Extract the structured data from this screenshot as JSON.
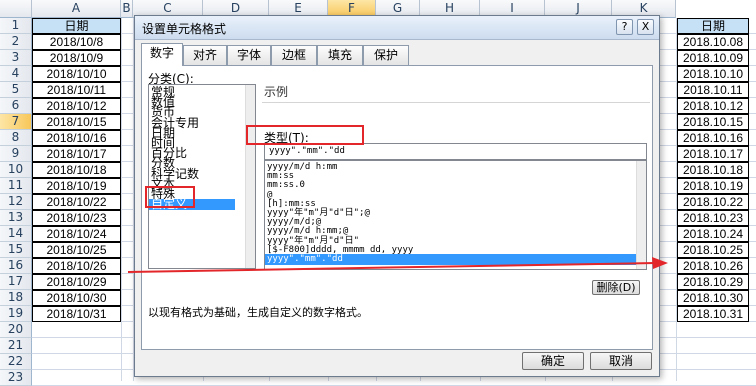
{
  "columns": [
    "A",
    "B",
    "C",
    "D",
    "E",
    "F",
    "G",
    "H",
    "I",
    "J",
    "K"
  ],
  "rows": [
    "1",
    "2",
    "3",
    "4",
    "5",
    "6",
    "7",
    "8",
    "9",
    "10",
    "11",
    "12",
    "13",
    "14",
    "15",
    "16",
    "17",
    "18",
    "19",
    "20",
    "21",
    "22",
    "23"
  ],
  "col_a": {
    "header": "日期",
    "values": [
      "2018/10/8",
      "2018/10/9",
      "2018/10/10",
      "2018/10/11",
      "2018/10/12",
      "2018/10/15",
      "2018/10/16",
      "2018/10/17",
      "2018/10/18",
      "2018/10/19",
      "2018/10/22",
      "2018/10/23",
      "2018/10/24",
      "2018/10/25",
      "2018/10/26",
      "2018/10/29",
      "2018/10/30",
      "2018/10/31"
    ]
  },
  "col_k": {
    "header": "日期",
    "values": [
      "2018.10.08",
      "2018.10.09",
      "2018.10.10",
      "2018.10.11",
      "2018.10.12",
      "2018.10.15",
      "2018.10.16",
      "2018.10.17",
      "2018.10.18",
      "2018.10.19",
      "2018.10.22",
      "2018.10.23",
      "2018.10.24",
      "2018.10.25",
      "2018.10.26",
      "2018.10.29",
      "2018.10.30",
      "2018.10.31"
    ]
  },
  "dialog": {
    "title": "设置单元格格式",
    "help": "?",
    "close": "X",
    "tabs": [
      "数字",
      "对齐",
      "字体",
      "边框",
      "填充",
      "保护"
    ],
    "category_label": "分类(C):",
    "categories": [
      "常规",
      "数值",
      "货币",
      "会计专用",
      "日期",
      "时间",
      "百分比",
      "分数",
      "科学记数",
      "文本",
      "特殊",
      "自定义"
    ],
    "sample_label": "示例",
    "type_label": "类型(T):",
    "type_value": "yyyy\".\"mm\".\"dd",
    "formats": [
      "yyyy/m/d h:mm",
      "mm:ss",
      "mm:ss.0",
      "@",
      "[h]:mm:ss",
      "yyyy\"年\"m\"月\"d\"日\";@",
      "yyyy/m/d;@",
      "yyyy/m/d h:mm;@",
      "yyyy\"年\"m\"月\"d\"日\"",
      "[$-F800]dddd, mmmm dd, yyyy",
      "yyyy\".\"mm\".\"dd"
    ],
    "delete_label": "删除(D)",
    "description": "以现有格式为基础，生成自定义的数字格式。",
    "ok_label": "确定",
    "cancel_label": "取消"
  },
  "colors": {
    "highlight": "#3399ff",
    "annotation": "#e3262a",
    "selected_header": "#f8c75a"
  }
}
